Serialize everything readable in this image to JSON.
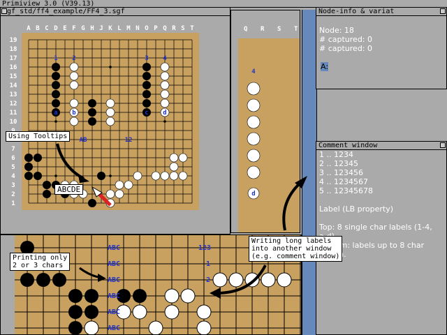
{
  "screen_title": "Primiview 3.0 (V39.13)",
  "board_window": {
    "title": "sgf_std/ff4_example/FF4_3.sgf"
  },
  "node_info": {
    "title": "Node-info & variat",
    "lines": [
      "Node: 18",
      "# captured: 0",
      "# captured: 0"
    ],
    "variation": "A:"
  },
  "comment": {
    "title": "Comment window",
    "lines": [
      "1 .. 1234",
      "2 .. 12345",
      "3 .. 123456",
      "4 .. 1234567",
      "5 .. 12345678",
      "",
      "Label (LB property)",
      "",
      "Top: 8 single char labels (1-4,",
      "a-d)",
      "Bottom: labels up to 8 char",
      "length."
    ]
  },
  "board": {
    "columns": [
      "A",
      "B",
      "C",
      "D",
      "E",
      "F",
      "G",
      "H",
      "J",
      "K",
      "L",
      "M",
      "N",
      "O",
      "P",
      "Q",
      "R",
      "S",
      "T"
    ],
    "rows": [
      "19",
      "18",
      "17",
      "16",
      "15",
      "14",
      "13",
      "12",
      "11",
      "10",
      "9",
      "8",
      "7",
      "6",
      "5",
      "4",
      "3",
      "2",
      "1"
    ],
    "top_labels": [
      [
        "1",
        "D",
        17
      ],
      [
        "2",
        "F",
        17
      ],
      [
        "3",
        "O",
        17
      ],
      [
        "4",
        "Q",
        17
      ],
      [
        "a",
        "D",
        11
      ],
      [
        "b",
        "F",
        11
      ],
      [
        "c",
        "O",
        11
      ],
      [
        "d",
        "Q",
        11
      ]
    ],
    "mid_labels": [
      [
        "AB",
        "G",
        8
      ],
      [
        "12",
        "M",
        8
      ]
    ],
    "black": [
      [
        "D",
        16
      ],
      [
        "D",
        15
      ],
      [
        "D",
        14
      ],
      [
        "D",
        13
      ],
      [
        "D",
        12
      ],
      [
        "D",
        11
      ],
      [
        "O",
        16
      ],
      [
        "O",
        15
      ],
      [
        "O",
        14
      ],
      [
        "O",
        13
      ],
      [
        "O",
        12
      ],
      [
        "O",
        11
      ],
      [
        "H",
        12
      ],
      [
        "H",
        11
      ],
      [
        "H",
        10
      ],
      [
        "A",
        6
      ],
      [
        "B",
        6
      ],
      [
        "A",
        5
      ],
      [
        "A",
        4
      ],
      [
        "B",
        4
      ],
      [
        "C",
        3
      ],
      [
        "D",
        3
      ],
      [
        "C",
        2
      ],
      [
        "E",
        2
      ],
      [
        "H",
        1
      ],
      [
        "J",
        4
      ]
    ],
    "white": [
      [
        "F",
        16
      ],
      [
        "F",
        15
      ],
      [
        "F",
        14
      ],
      [
        "F",
        12
      ],
      [
        "F",
        11
      ],
      [
        "F",
        10
      ],
      [
        "K",
        12
      ],
      [
        "K",
        11
      ],
      [
        "K",
        10
      ],
      [
        "Q",
        16
      ],
      [
        "Q",
        15
      ],
      [
        "Q",
        14
      ],
      [
        "Q",
        13
      ],
      [
        "Q",
        12
      ],
      [
        "Q",
        11
      ],
      [
        "R",
        6
      ],
      [
        "S",
        6
      ],
      [
        "R",
        5
      ],
      [
        "Q",
        4
      ],
      [
        "R",
        4
      ],
      [
        "S",
        4
      ],
      [
        "P",
        4
      ],
      [
        "N",
        4
      ],
      [
        "L",
        3
      ],
      [
        "M",
        3
      ],
      [
        "K",
        2
      ],
      [
        "L",
        2
      ],
      [
        "K",
        1
      ],
      [
        "E",
        3
      ],
      [
        "F",
        3
      ],
      [
        "F",
        2
      ],
      [
        "G",
        2
      ]
    ]
  },
  "right_board": {
    "labels": [
      "Q",
      "R",
      "S",
      "T"
    ],
    "mark4": "4",
    "markd": "d"
  },
  "bottom_board": {
    "labels": [
      [
        "ABC",
        150,
        353
      ],
      [
        "ABC",
        150,
        376
      ],
      [
        "ABC",
        150,
        399
      ],
      [
        "ABC",
        150,
        422
      ],
      [
        "ABC",
        150,
        445
      ],
      [
        "ABC",
        150,
        468
      ],
      [
        "123",
        280,
        353
      ],
      [
        "1",
        285,
        376
      ],
      [
        "2",
        285,
        399
      ]
    ]
  },
  "callouts": {
    "tooltips": "Using Tooltips",
    "tooltip_box": "ABCDE",
    "printing": "Printing only\n2 or 3 chars",
    "writing": "Writing long labels\ninto another window\n(e.g. comment window)"
  }
}
